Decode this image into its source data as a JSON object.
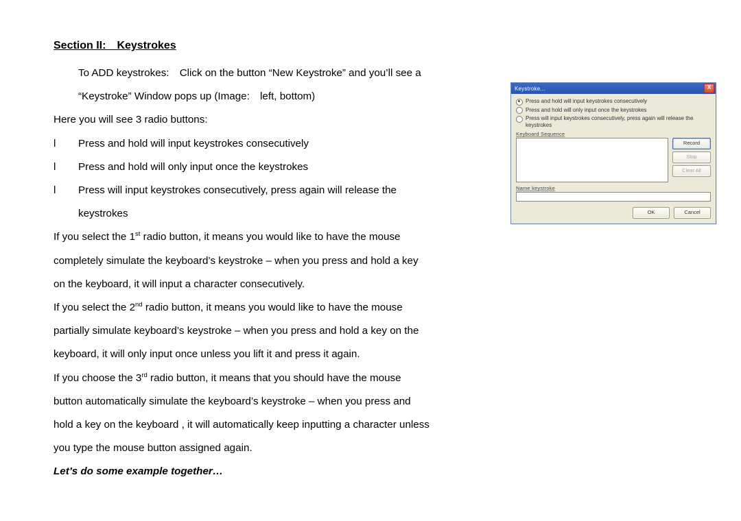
{
  "section_title": "Section II: Keystrokes",
  "intro_line1": "To ADD keystrokes: Click on the button “New Keystroke” and you’ll see a",
  "intro_line2": "“Keystroke” Window pops up (Image: left, bottom)",
  "radio_intro": "Here you will see 3 radio buttons:",
  "bullets": {
    "mark": "l",
    "b1": "Press and hold will input keystrokes consecutively",
    "b2": "Press and hold will only input once the keystrokes",
    "b3a": "Press will input keystrokes consecutively, press again will release the",
    "b3b": "keystrokes"
  },
  "para1": {
    "pre": "If you select the 1",
    "sup": "st",
    "post": " radio button, it means you would like to have the mouse",
    "l2": "completely simulate the keyboard’s keystroke – when you press and hold a key",
    "l3": "on the keyboard, it will input a character consecutively."
  },
  "para2": {
    "pre": "If you select the 2",
    "sup": "nd",
    "post": " radio button, it means you would like to have the mouse",
    "l2": "partially simulate keyboard’s keystroke – when you press and hold a key on the",
    "l3": "keyboard, it will only input once unless you lift it and press it again."
  },
  "para3": {
    "pre": "If you choose the 3",
    "sup": "rd",
    "post": " radio button, it means that you should have the mouse",
    "l2": "button automatically simulate the keyboard’s keystroke – when you press and",
    "l3": "hold a key on the keyboard , it will automatically keep inputting a character unless",
    "l4": "you type the mouse button assigned again."
  },
  "closing": "Let’s do some example together…",
  "dialog": {
    "title": "Keystroke...",
    "close_glyph": "X",
    "radios": {
      "r1": "Press and hold will input keystrokes consecutively",
      "r2": "Press and hold will only input once the keystrokes",
      "r3": "Press will input keystrokes consecutively, press again will release the keystrokes"
    },
    "seq_label": "Keyboard Sequence",
    "btn_record": "Record",
    "btn_stop": "Stop",
    "btn_clear": "Clear All",
    "name_label": "Name keystroke",
    "btn_ok": "OK",
    "btn_cancel": "Cancel"
  }
}
